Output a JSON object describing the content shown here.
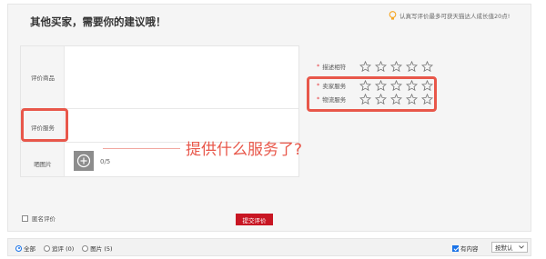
{
  "review": {
    "heading": "其他买家，需要你的建议哦！",
    "tip": "认真写评价最多可获天猫达人成长值20点!",
    "labels": {
      "product": "评价商品",
      "service": "评价服务",
      "photo": "晒图片"
    },
    "photo_count": "0/5",
    "annotation": "提供什么服务了?",
    "ratings": [
      {
        "label": "描述相符",
        "stars": 5,
        "selected": 0
      },
      {
        "label": "卖家服务",
        "stars": 5,
        "selected": 0
      },
      {
        "label": "物流服务",
        "stars": 5,
        "selected": 0
      }
    ],
    "anonymous_label": "匿名评价",
    "submit_label": "提交评价"
  },
  "filter": {
    "options": [
      {
        "label": "全部",
        "selected": true
      },
      {
        "label": "追评 (0)",
        "selected": false
      },
      {
        "label": "图片 (5)",
        "selected": false
      }
    ],
    "has_content_label": "有内容",
    "has_content_checked": true,
    "sort_value": "按默认"
  },
  "colors": {
    "accent_red": "#e8574a",
    "submit_bg": "#c81623",
    "tip_icon": "#f5a623"
  },
  "icons": {
    "tip": "lightbulb-icon",
    "add_photo": "plus-circle-icon",
    "rating": "star-outline-icon",
    "sort": "chevron-down-icon"
  }
}
